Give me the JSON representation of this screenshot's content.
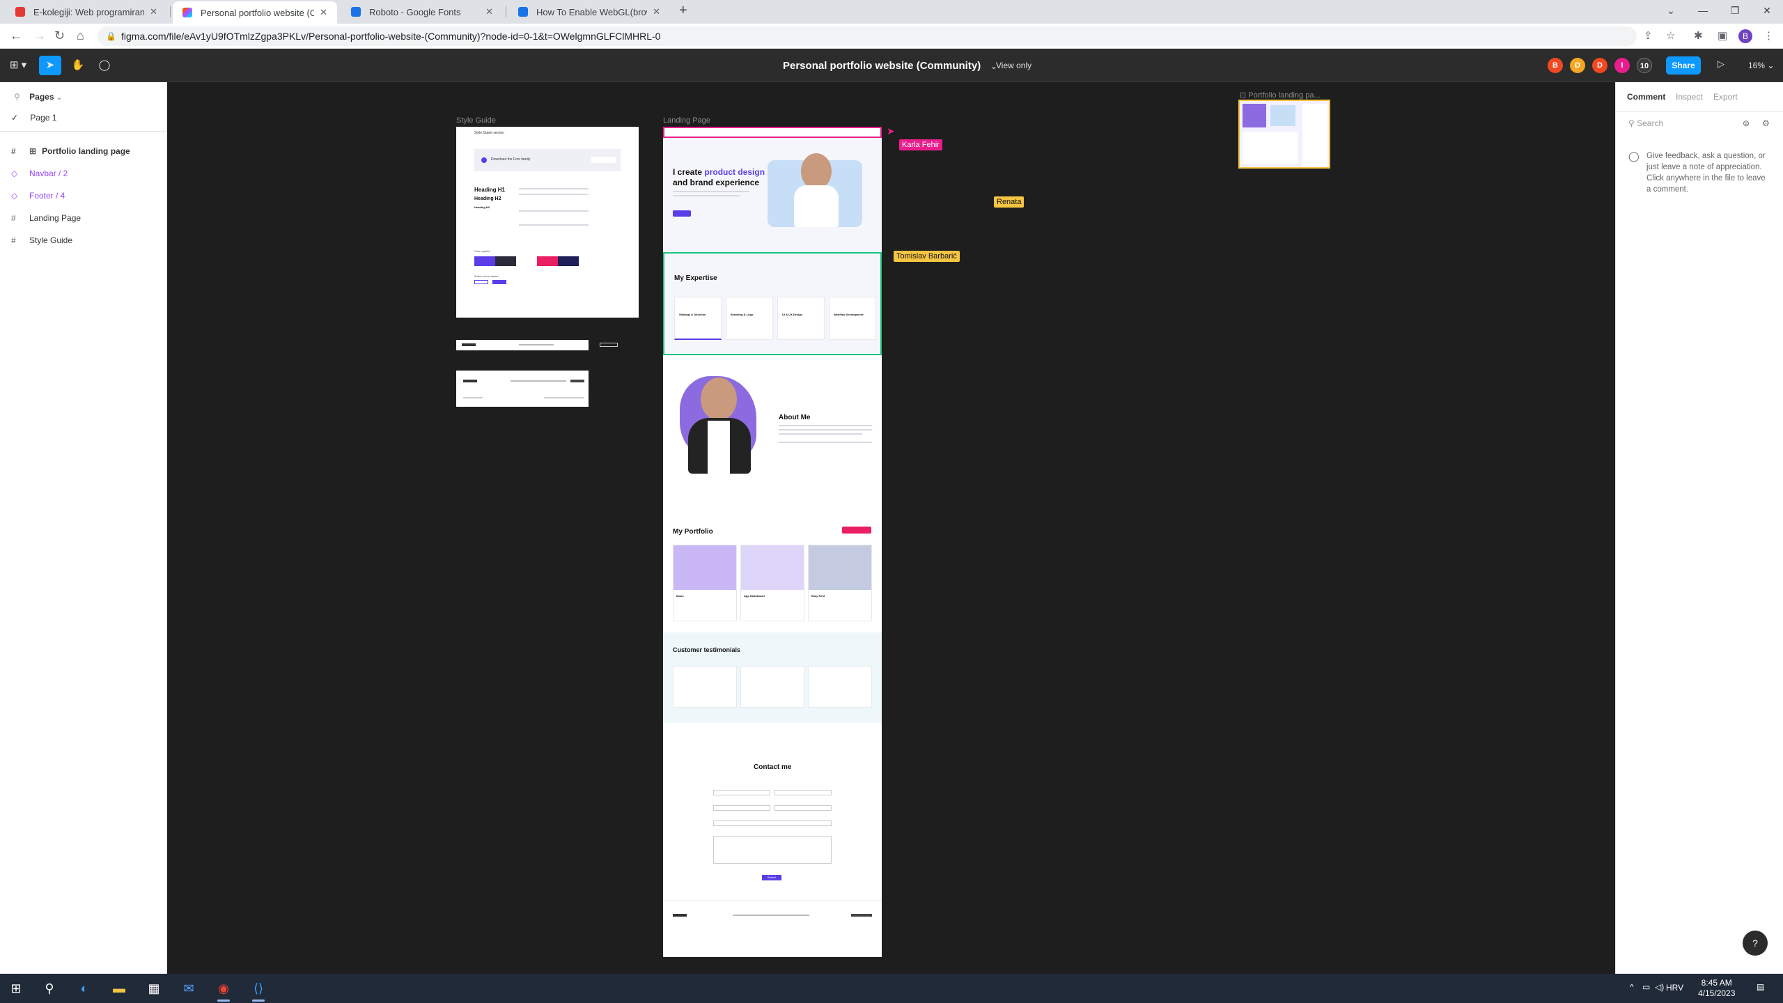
{
  "browser": {
    "tabs": [
      {
        "title": "E-kolegiji: Web programiranje",
        "favicon_color": "#e53935"
      },
      {
        "title": "Personal portfolio website (Comm",
        "favicon_color": "#f24e1e"
      },
      {
        "title": "Roboto - Google Fonts",
        "favicon_color": "#1a73e8"
      },
      {
        "title": "How To Enable WebGL(browser)",
        "favicon_color": "#1a73e8"
      }
    ],
    "url": "figma.com/file/eAv1yU9fOTmlzZgpa3PKLv/Personal-portfolio-website-(Community)?node-id=0-1&t=OWelgmnGLFClMHRL-0",
    "profile_initial": "B"
  },
  "figma": {
    "file_title": "Personal portfolio website (Community)",
    "view_only": "View only",
    "avatars": [
      {
        "letter": "B",
        "color": "#f24822"
      },
      {
        "letter": "D",
        "color": "#f5a623"
      },
      {
        "letter": "D",
        "color": "#f24822"
      },
      {
        "letter": "I",
        "color": "#e91e8c"
      }
    ],
    "collaborator_count": "10",
    "share_label": "Share",
    "zoom": "16%",
    "left_panel": {
      "pages_label": "Pages",
      "current_page": "Page 1",
      "layers": [
        {
          "label": "Portfolio landing page",
          "icon": "frame-icon",
          "bold": true
        },
        {
          "label": "Navbar / 2",
          "icon": "component-icon"
        },
        {
          "label": "Footer / 4",
          "icon": "component-icon"
        },
        {
          "label": "Landing Page",
          "icon": "frame-icon"
        },
        {
          "label": "Style Guide",
          "icon": "frame-icon"
        }
      ]
    },
    "right_panel": {
      "tabs": [
        "Comment",
        "Inspect",
        "Export"
      ],
      "search_placeholder": "Search",
      "feedback_text": "Give feedback, ask a question, or just leave a note of appreciation. Click anywhere in the file to leave a comment."
    },
    "canvas": {
      "frame_labels": {
        "style_guide": "Style Guide",
        "landing_page": "Landing Page",
        "portfolio_landing": "Portfolio landing pa..."
      },
      "cursors": [
        {
          "name": "Karla Fehir",
          "color": "#e91e8c"
        },
        {
          "name": "Tomislav Barbarić",
          "color": "#f5c542"
        },
        {
          "name": "Renata",
          "color": "#f5c542"
        }
      ],
      "style_guide": {
        "section_title": "Style Guide section",
        "download_text": "Download the Font family",
        "heading_h1": "Heading H1",
        "heading_h2": "Heading H2",
        "heading_h3": "Heading H3",
        "color_palette": "Color palette",
        "button_hover": "Button hover states"
      },
      "landing": {
        "hero_line1_prefix": "I create ",
        "hero_highlight": "product design",
        "hero_line2": "and brand experience",
        "expertise_title": "My Expertise",
        "expertise_cards": [
          "Strategy & Direction",
          "Branding & Logo",
          "UI & UX Design",
          "Webflow Development"
        ],
        "about_title": "About Me",
        "portfolio_title": "My Portfolio",
        "portfolio_cards": [
          "Moon",
          "App Dashboard",
          "Easy Rent"
        ],
        "testimonials_title": "Customer testimonials",
        "contact_title": "Contact me",
        "submit_label": "Submit"
      }
    }
  },
  "taskbar": {
    "language": "HRV",
    "time": "8:45 AM",
    "date": "4/15/2023"
  },
  "colors": {
    "accent": "#0d99ff",
    "brand_purple": "#5b3de8",
    "pink": "#e91e63"
  }
}
